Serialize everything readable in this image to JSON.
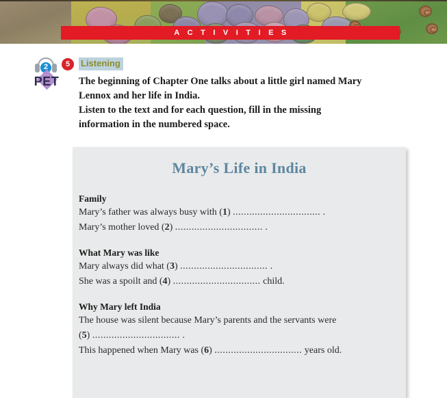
{
  "banner": {
    "strip_label": "ACTIVITIES"
  },
  "exercise": {
    "audio_track": "2",
    "exam_logo": "PET",
    "number": "5",
    "skill": "Listening",
    "instruction_lines": [
      "The beginning of Chapter One talks about a little girl named Mary",
      "Lennox and her life in India.",
      "Listen to the text and for each question, fill in the missing",
      "information in the numbered space."
    ]
  },
  "worksheet": {
    "title": "Mary’s Life in India",
    "sections": [
      {
        "heading": "Family",
        "lines": [
          {
            "pre": "Mary’s father was always busy with (",
            "num": "1",
            "mid": ") ",
            "dots": "................................",
            "post": " ."
          },
          {
            "pre": "Mary’s mother loved (",
            "num": "2",
            "mid": ") ",
            "dots": "................................",
            "post": " ."
          }
        ]
      },
      {
        "heading": "What Mary was like",
        "lines": [
          {
            "pre": "Mary always did what (",
            "num": "3",
            "mid": ") ",
            "dots": "................................",
            "post": " ."
          },
          {
            "pre": "She was a spoilt and (",
            "num": "4",
            "mid": ") ",
            "dots": "................................",
            "post": " child."
          }
        ]
      },
      {
        "heading": "Why Mary left India",
        "lines": [
          {
            "pre": "The house was silent because Mary’s parents and the servants were",
            "num": "",
            "mid": "",
            "dots": "",
            "post": ""
          },
          {
            "pre": "(",
            "num": "5",
            "mid": ") ",
            "dots": "................................",
            "post": " ."
          },
          {
            "pre": "This happened when Mary was (",
            "num": "6",
            "mid": ") ",
            "dots": "................................",
            "post": " years old."
          }
        ]
      }
    ]
  },
  "colors": {
    "strip_red": "#e21b24",
    "task_red": "#d8232a",
    "skill_text": "#8b8c2c",
    "skill_highlight": "#bcd3dd",
    "title_blue": "#5d87a0",
    "card_gray": "#e9eaeb",
    "disc_blue": "#1b8fd4",
    "pet_purple": "#b48ecd"
  }
}
